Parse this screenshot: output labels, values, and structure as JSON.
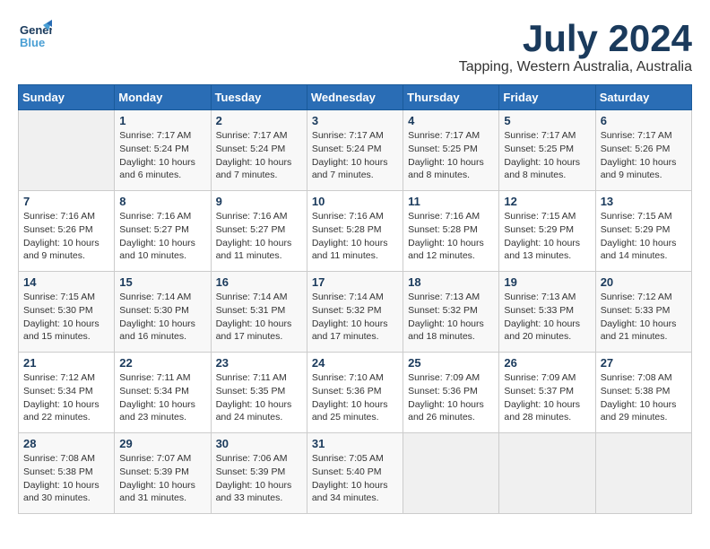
{
  "header": {
    "logo_general": "General",
    "logo_blue": "Blue",
    "month": "July 2024",
    "location": "Tapping, Western Australia, Australia"
  },
  "weekdays": [
    "Sunday",
    "Monday",
    "Tuesday",
    "Wednesday",
    "Thursday",
    "Friday",
    "Saturday"
  ],
  "weeks": [
    [
      {
        "day": "",
        "info": ""
      },
      {
        "day": "1",
        "info": "Sunrise: 7:17 AM\nSunset: 5:24 PM\nDaylight: 10 hours\nand 6 minutes."
      },
      {
        "day": "2",
        "info": "Sunrise: 7:17 AM\nSunset: 5:24 PM\nDaylight: 10 hours\nand 7 minutes."
      },
      {
        "day": "3",
        "info": "Sunrise: 7:17 AM\nSunset: 5:24 PM\nDaylight: 10 hours\nand 7 minutes."
      },
      {
        "day": "4",
        "info": "Sunrise: 7:17 AM\nSunset: 5:25 PM\nDaylight: 10 hours\nand 8 minutes."
      },
      {
        "day": "5",
        "info": "Sunrise: 7:17 AM\nSunset: 5:25 PM\nDaylight: 10 hours\nand 8 minutes."
      },
      {
        "day": "6",
        "info": "Sunrise: 7:17 AM\nSunset: 5:26 PM\nDaylight: 10 hours\nand 9 minutes."
      }
    ],
    [
      {
        "day": "7",
        "info": "Sunrise: 7:16 AM\nSunset: 5:26 PM\nDaylight: 10 hours\nand 9 minutes."
      },
      {
        "day": "8",
        "info": "Sunrise: 7:16 AM\nSunset: 5:27 PM\nDaylight: 10 hours\nand 10 minutes."
      },
      {
        "day": "9",
        "info": "Sunrise: 7:16 AM\nSunset: 5:27 PM\nDaylight: 10 hours\nand 11 minutes."
      },
      {
        "day": "10",
        "info": "Sunrise: 7:16 AM\nSunset: 5:28 PM\nDaylight: 10 hours\nand 11 minutes."
      },
      {
        "day": "11",
        "info": "Sunrise: 7:16 AM\nSunset: 5:28 PM\nDaylight: 10 hours\nand 12 minutes."
      },
      {
        "day": "12",
        "info": "Sunrise: 7:15 AM\nSunset: 5:29 PM\nDaylight: 10 hours\nand 13 minutes."
      },
      {
        "day": "13",
        "info": "Sunrise: 7:15 AM\nSunset: 5:29 PM\nDaylight: 10 hours\nand 14 minutes."
      }
    ],
    [
      {
        "day": "14",
        "info": "Sunrise: 7:15 AM\nSunset: 5:30 PM\nDaylight: 10 hours\nand 15 minutes."
      },
      {
        "day": "15",
        "info": "Sunrise: 7:14 AM\nSunset: 5:30 PM\nDaylight: 10 hours\nand 16 minutes."
      },
      {
        "day": "16",
        "info": "Sunrise: 7:14 AM\nSunset: 5:31 PM\nDaylight: 10 hours\nand 17 minutes."
      },
      {
        "day": "17",
        "info": "Sunrise: 7:14 AM\nSunset: 5:32 PM\nDaylight: 10 hours\nand 17 minutes."
      },
      {
        "day": "18",
        "info": "Sunrise: 7:13 AM\nSunset: 5:32 PM\nDaylight: 10 hours\nand 18 minutes."
      },
      {
        "day": "19",
        "info": "Sunrise: 7:13 AM\nSunset: 5:33 PM\nDaylight: 10 hours\nand 20 minutes."
      },
      {
        "day": "20",
        "info": "Sunrise: 7:12 AM\nSunset: 5:33 PM\nDaylight: 10 hours\nand 21 minutes."
      }
    ],
    [
      {
        "day": "21",
        "info": "Sunrise: 7:12 AM\nSunset: 5:34 PM\nDaylight: 10 hours\nand 22 minutes."
      },
      {
        "day": "22",
        "info": "Sunrise: 7:11 AM\nSunset: 5:34 PM\nDaylight: 10 hours\nand 23 minutes."
      },
      {
        "day": "23",
        "info": "Sunrise: 7:11 AM\nSunset: 5:35 PM\nDaylight: 10 hours\nand 24 minutes."
      },
      {
        "day": "24",
        "info": "Sunrise: 7:10 AM\nSunset: 5:36 PM\nDaylight: 10 hours\nand 25 minutes."
      },
      {
        "day": "25",
        "info": "Sunrise: 7:09 AM\nSunset: 5:36 PM\nDaylight: 10 hours\nand 26 minutes."
      },
      {
        "day": "26",
        "info": "Sunrise: 7:09 AM\nSunset: 5:37 PM\nDaylight: 10 hours\nand 28 minutes."
      },
      {
        "day": "27",
        "info": "Sunrise: 7:08 AM\nSunset: 5:38 PM\nDaylight: 10 hours\nand 29 minutes."
      }
    ],
    [
      {
        "day": "28",
        "info": "Sunrise: 7:08 AM\nSunset: 5:38 PM\nDaylight: 10 hours\nand 30 minutes."
      },
      {
        "day": "29",
        "info": "Sunrise: 7:07 AM\nSunset: 5:39 PM\nDaylight: 10 hours\nand 31 minutes."
      },
      {
        "day": "30",
        "info": "Sunrise: 7:06 AM\nSunset: 5:39 PM\nDaylight: 10 hours\nand 33 minutes."
      },
      {
        "day": "31",
        "info": "Sunrise: 7:05 AM\nSunset: 5:40 PM\nDaylight: 10 hours\nand 34 minutes."
      },
      {
        "day": "",
        "info": ""
      },
      {
        "day": "",
        "info": ""
      },
      {
        "day": "",
        "info": ""
      }
    ]
  ]
}
